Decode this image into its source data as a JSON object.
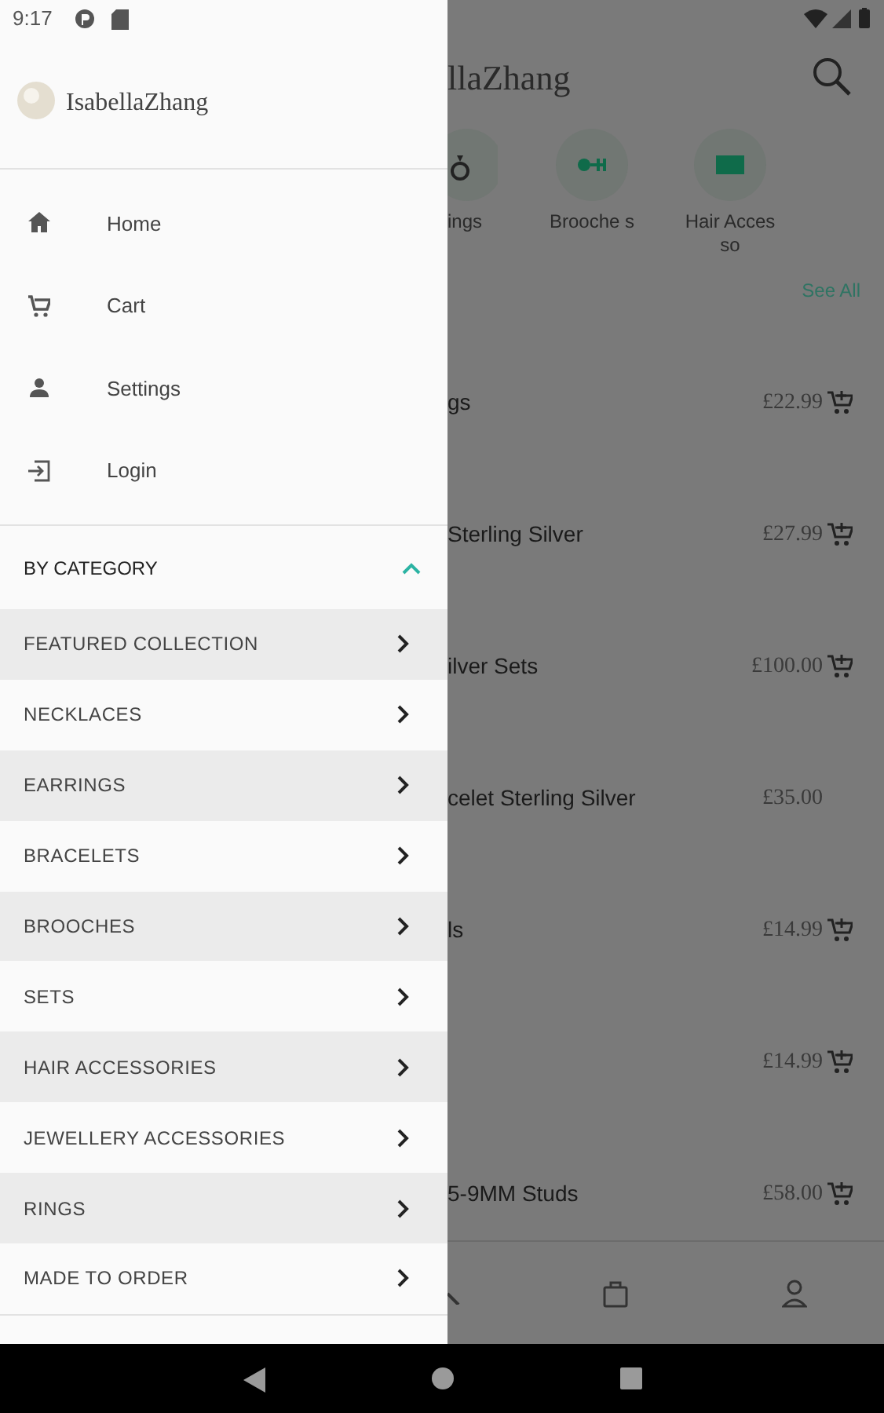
{
  "status_bar": {
    "time": "9:17"
  },
  "drawer": {
    "brand": "IsabellaZhang",
    "menu": [
      {
        "label": "Home"
      },
      {
        "label": "Cart"
      },
      {
        "label": "Settings"
      },
      {
        "label": "Login"
      }
    ],
    "category_header": {
      "label": "BY CATEGORY",
      "expanded": true
    },
    "categories": [
      "FEATURED COLLECTION",
      "NECKLACES",
      "EARRINGS",
      "BRACELETS",
      "BROOCHES",
      "SETS",
      "HAIR ACCESSORIES",
      "JEWELLERY ACCESSORIES",
      "RINGS",
      "MADE TO ORDER"
    ]
  },
  "background": {
    "title": "llaZhang",
    "categories": [
      {
        "label": "ings"
      },
      {
        "label": "Brooche s"
      },
      {
        "label": "Hair Accesso"
      }
    ],
    "see_all": "See All",
    "products": [
      {
        "name": "gs",
        "price": "£22.99",
        "cart_icon": true
      },
      {
        "name": "Sterling Silver",
        "price": "£27.99",
        "cart_icon": true
      },
      {
        "name": "ilver Sets",
        "price": "£100.00",
        "cart_icon": true
      },
      {
        "name": "celet Sterling Silver",
        "price": "£35.00",
        "cart_icon": false
      },
      {
        "name": "ls",
        "price": "£14.99",
        "cart_icon": true
      },
      {
        "price": "£14.99",
        "cart_icon": true
      },
      {
        "name": "5-9MM Studs",
        "price": "£58.00",
        "cart_icon": true
      }
    ]
  }
}
